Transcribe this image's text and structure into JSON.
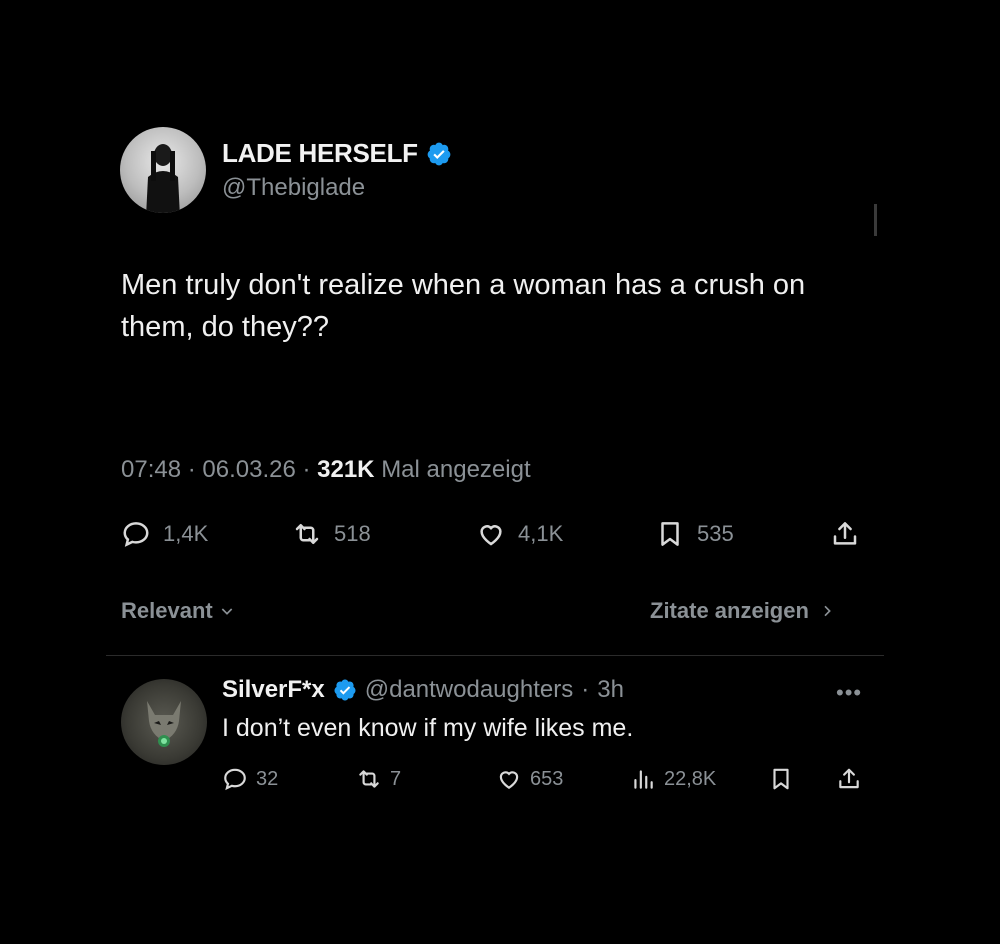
{
  "tweet": {
    "author_name": "LADE HERSELF",
    "author_handle": "@Thebiglade",
    "text": "Men truly don't realize when a woman has a crush on them, do they??",
    "time": "07:48",
    "date": "06.03.26",
    "views_count": "321K",
    "views_label": "Mal angezeigt",
    "stats": {
      "replies": "1,4K",
      "reposts": "518",
      "likes": "4,1K",
      "bookmarks": "535"
    }
  },
  "sort": {
    "label": "Relevant",
    "quotes_label": "Zitate anzeigen"
  },
  "reply": {
    "author_name": "SilverF*x",
    "author_handle": "@dantwodaughters",
    "age": "3h",
    "text": "I don’t even know if my wife likes me.",
    "stats": {
      "replies": "32",
      "reposts": "7",
      "likes": "653",
      "views": "22,8K"
    }
  },
  "colors": {
    "background": "#000000",
    "verified": "#1d9bf0",
    "muted": "#8b9196",
    "text": "#f0f0f0"
  },
  "icons": [
    "verified-badge-icon",
    "reply-icon",
    "repost-icon",
    "like-icon",
    "bookmark-icon",
    "share-icon",
    "views-icon",
    "chevron-down-icon",
    "chevron-right-icon",
    "more-icon"
  ]
}
